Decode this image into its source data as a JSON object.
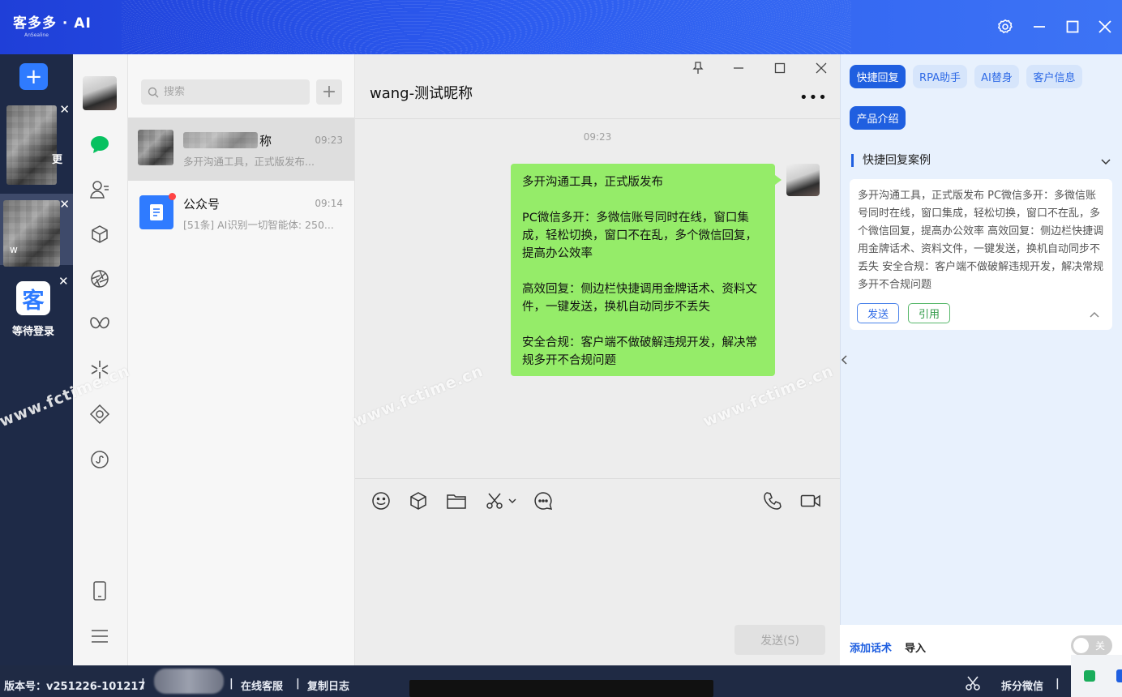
{
  "titlebar": {
    "brand": "客多多 · AI",
    "brand_sub": "AnSealine"
  },
  "accounts": {
    "add_label": "+",
    "waiting_label": "等待登录",
    "ke_logo": "客",
    "blurred_suffix_1": "更",
    "blurred_suffix_2": "w"
  },
  "search": {
    "placeholder": "搜索"
  },
  "conversations": [
    {
      "name": "称",
      "time": "09:23",
      "preview": "多开沟通工具，正式版发布..."
    },
    {
      "name": "公众号",
      "time": "09:14",
      "preview": "[51条] AI识别一切智能体: 250..."
    }
  ],
  "chat": {
    "title": "wang-测试昵称",
    "message_time": "09:23",
    "message": "多开沟通工具，正式版发布\n\nPC微信多开：多微信账号同时在线，窗口集成，轻松切换，窗口不在乱，多个微信回复，提高办公效率\n\n高效回复：侧边栏快捷调用金牌话术、资料文件，一键发送，换机自动同步不丢失\n\n安全合规：客户端不做破解违规开发，解决常规多开不合规问题",
    "send_label": "发送(S)"
  },
  "right_panel": {
    "tabs": [
      "快捷回复",
      "RPA助手",
      "AI替身",
      "客户信息",
      "产品介绍"
    ],
    "section_title": "快捷回复案例",
    "card_text": "多开沟通工具，正式版发布 PC微信多开：多微信账号同时在线，窗口集成，轻松切换，窗口不在乱，多个微信回复，提高办公效率 高效回复：侧边栏快捷调用金牌话术、资料文件，一键发送，换机自动同步不丢失 安全合规：客户端不做破解违规开发，解决常规多开不合规问题",
    "send_label": "发送",
    "cite_label": "引用",
    "add_phrase": "添加话术",
    "import": "导入",
    "toggle_label": "关"
  },
  "statusbar": {
    "version": "版本号：v251226-101217",
    "sep": "|",
    "online_service": "在线客服",
    "copy_log": "复制日志",
    "split_wechat": "拆分微信"
  },
  "watermark": "www.fctime.cn",
  "colors": {
    "accent": "#1f5fe0",
    "bubble": "#95ec69",
    "sidebar": "#1e2a47"
  }
}
